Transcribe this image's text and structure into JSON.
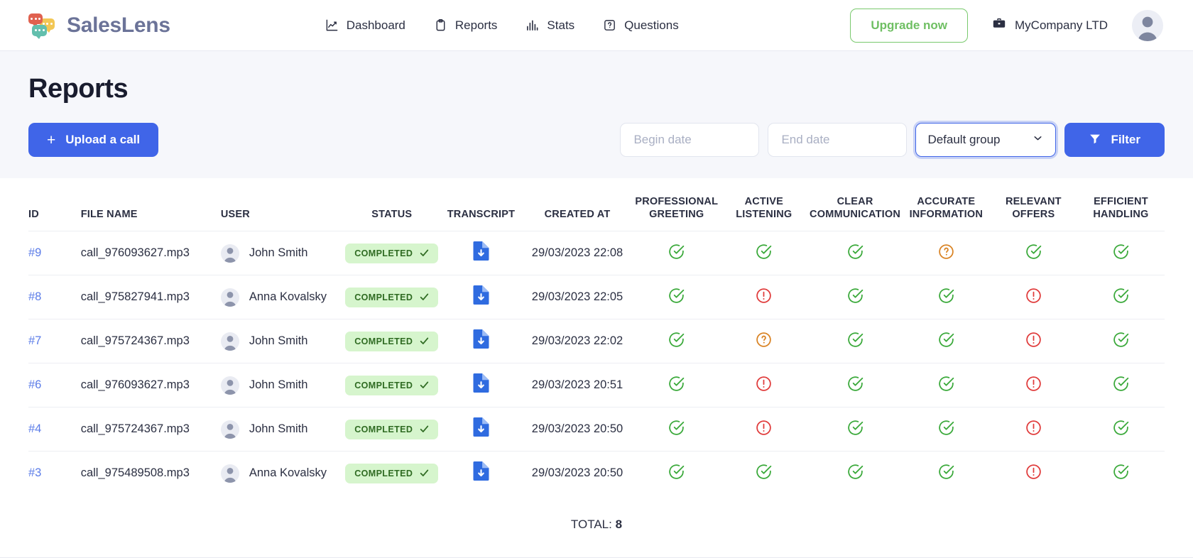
{
  "header": {
    "brand_name": "SalesLens",
    "nav": [
      {
        "label": "Dashboard",
        "icon": "chart-line-icon"
      },
      {
        "label": "Reports",
        "icon": "clipboard-icon"
      },
      {
        "label": "Stats",
        "icon": "bar-chart-icon"
      },
      {
        "label": "Questions",
        "icon": "question-box-icon"
      }
    ],
    "upgrade_label": "Upgrade now",
    "company_name": "MyCompany LTD",
    "company_icon": "briefcase-icon",
    "avatar_icon": "user-avatar-icon"
  },
  "page": {
    "title": "Reports",
    "upload_label": "Upload a call",
    "upload_plus": "+",
    "begin_date_placeholder": "Begin date",
    "begin_date_value": "",
    "end_date_placeholder": "End date",
    "end_date_value": "",
    "group_select_value": "Default group",
    "filter_label": "Filter"
  },
  "table": {
    "columns": [
      "ID",
      "FILE NAME",
      "USER",
      "STATUS",
      "TRANSCRIPT",
      "CREATED AT",
      "PROFESSIONAL\nGREETING",
      "ACTIVE\nLISTENING",
      "CLEAR\nCOMMUNICATION",
      "ACCURATE\nINFORMATION",
      "RELEVANT\nOFFERS",
      "EFFICIENT\nHANDLING"
    ],
    "rows": [
      {
        "id": "#9",
        "file": "call_976093627.mp3",
        "user": "John Smith",
        "status": "COMPLETED",
        "created": "29/03/2023 22:08",
        "metrics": [
          "ok",
          "ok",
          "ok",
          "warn",
          "ok",
          "ok"
        ]
      },
      {
        "id": "#8",
        "file": "call_975827941.mp3",
        "user": "Anna Kovalsky",
        "status": "COMPLETED",
        "created": "29/03/2023 22:05",
        "metrics": [
          "ok",
          "bad",
          "ok",
          "ok",
          "bad",
          "ok"
        ]
      },
      {
        "id": "#7",
        "file": "call_975724367.mp3",
        "user": "John Smith",
        "status": "COMPLETED",
        "created": "29/03/2023 22:02",
        "metrics": [
          "ok",
          "warn",
          "ok",
          "ok",
          "bad",
          "ok"
        ]
      },
      {
        "id": "#6",
        "file": "call_976093627.mp3",
        "user": "John Smith",
        "status": "COMPLETED",
        "created": "29/03/2023 20:51",
        "metrics": [
          "ok",
          "bad",
          "ok",
          "ok",
          "bad",
          "ok"
        ]
      },
      {
        "id": "#4",
        "file": "call_975724367.mp3",
        "user": "John Smith",
        "status": "COMPLETED",
        "created": "29/03/2023 20:50",
        "metrics": [
          "ok",
          "bad",
          "ok",
          "ok",
          "bad",
          "ok"
        ]
      },
      {
        "id": "#3",
        "file": "call_975489508.mp3",
        "user": "Anna Kovalsky",
        "status": "COMPLETED",
        "created": "29/03/2023 20:50",
        "metrics": [
          "ok",
          "ok",
          "ok",
          "ok",
          "bad",
          "ok"
        ]
      }
    ],
    "total_label": "TOTAL:",
    "total_value": "8"
  },
  "colors": {
    "primary": "#4065e8",
    "upgrade_green": "#6fbf63",
    "badge_bg": "#d6f5cd",
    "badge_text": "#2f6b22",
    "metric_ok": "#3aa93a",
    "metric_warn": "#d98324",
    "metric_bad": "#e03b3b",
    "id_link": "#5b7ce8"
  }
}
